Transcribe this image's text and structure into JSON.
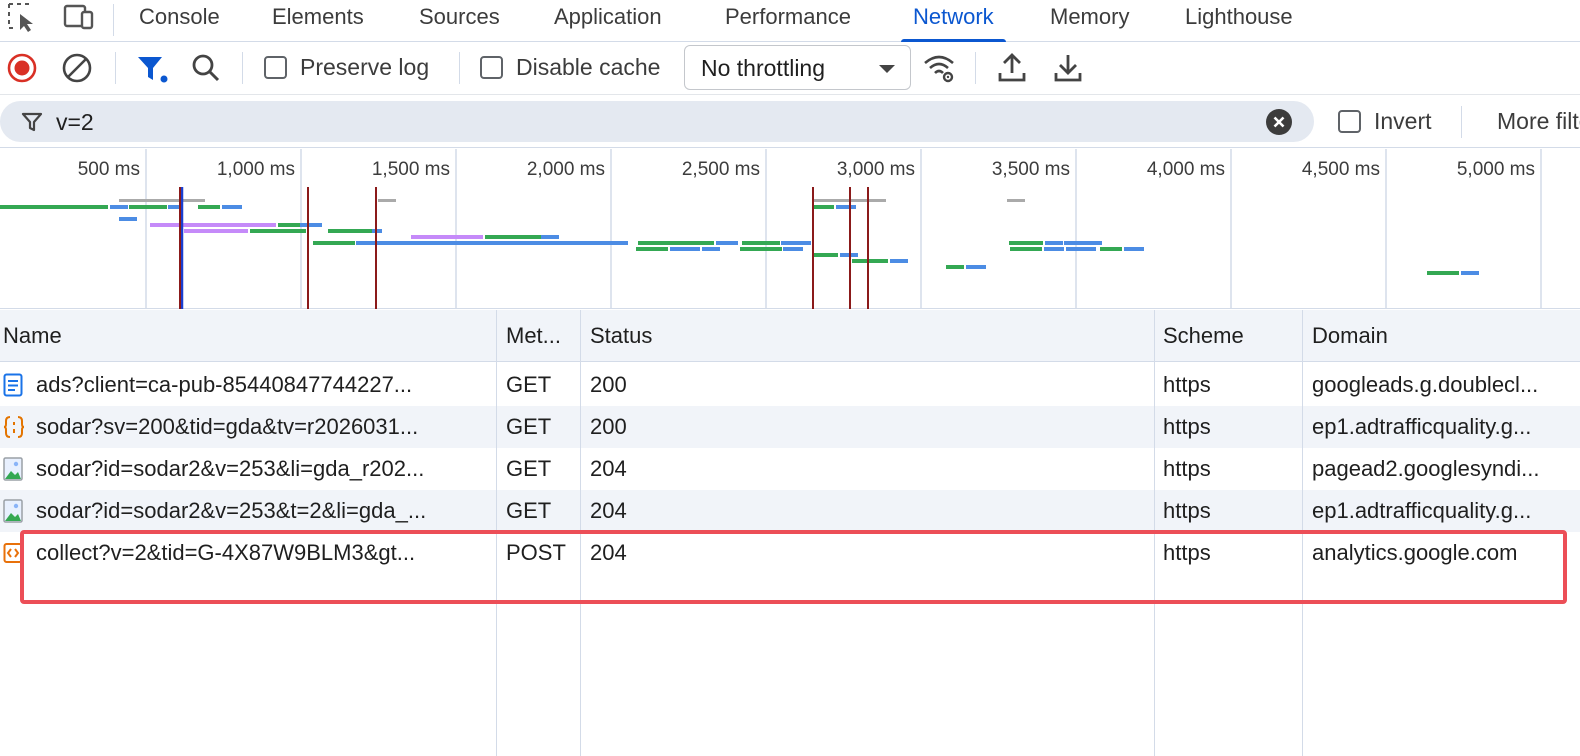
{
  "tabs": [
    {
      "label": "Console",
      "active": false
    },
    {
      "label": "Elements",
      "active": false
    },
    {
      "label": "Sources",
      "active": false
    },
    {
      "label": "Application",
      "active": false
    },
    {
      "label": "Performance",
      "active": false
    },
    {
      "label": "Network",
      "active": true
    },
    {
      "label": "Memory",
      "active": false
    },
    {
      "label": "Lighthouse",
      "active": false
    }
  ],
  "toolbar": {
    "preserve_log": {
      "label": "Preserve log",
      "checked": false
    },
    "disable_cache": {
      "label": "Disable cache",
      "checked": false
    },
    "throttling": "No throttling",
    "icons": [
      "record-stop-icon",
      "clear-icon",
      "filter-icon",
      "search-icon",
      "network-conditions-icon",
      "import-har-icon",
      "export-har-icon"
    ]
  },
  "filter": {
    "value": "v=2",
    "invert_label": "Invert",
    "more_filters_label": "More filters"
  },
  "overview": {
    "ticks": [
      "500 ms",
      "1,000 ms",
      "1,500 ms",
      "2,000 ms",
      "2,500 ms",
      "3,000 ms",
      "3,500 ms",
      "4,000 ms",
      "4,500 ms",
      "5,000 ms"
    ]
  },
  "columns": {
    "name": "Name",
    "method": "Met...",
    "status": "Status",
    "scheme": "Scheme",
    "domain": "Domain"
  },
  "rows": [
    {
      "icon": "document-icon",
      "name": "ads?client=ca-pub-85440847744227...",
      "method": "GET",
      "status": "200",
      "scheme": "https",
      "domain": "googleads.g.doublecl..."
    },
    {
      "icon": "script-icon",
      "name": "sodar?sv=200&tid=gda&tv=r2026031...",
      "method": "GET",
      "status": "200",
      "scheme": "https",
      "domain": "ep1.adtrafficquality.g..."
    },
    {
      "icon": "image-icon",
      "name": "sodar?id=sodar2&v=253&li=gda_r202...",
      "method": "GET",
      "status": "204",
      "scheme": "https",
      "domain": "pagead2.googlesyndi..."
    },
    {
      "icon": "image-icon",
      "name": "sodar?id=sodar2&v=253&t=2&li=gda_...",
      "method": "GET",
      "status": "204",
      "scheme": "https",
      "domain": "ep1.adtrafficquality.g..."
    },
    {
      "icon": "ping-icon",
      "name": "collect?v=2&tid=G-4X87W9BLM3&gt...",
      "method": "POST",
      "status": "204",
      "scheme": "https",
      "domain": "analytics.google.com"
    }
  ],
  "colors": {
    "accent": "#0b57d0",
    "record": "#d93025",
    "highlight": "#ec4e57",
    "bar_green": "#34a853",
    "bar_blue": "#4c8ce4",
    "bar_gray": "#aaaaaa",
    "bar_purple": "#c58af9",
    "marker_red": "#8b1a1a"
  }
}
